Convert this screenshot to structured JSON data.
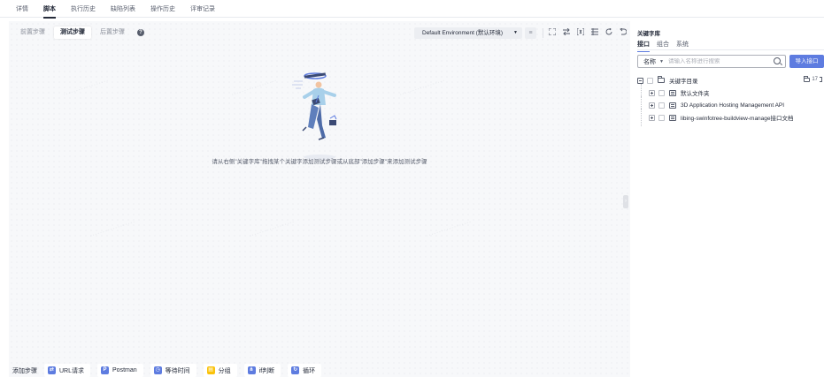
{
  "top_tabs": [
    {
      "label": "详情",
      "active": false
    },
    {
      "label": "脚本",
      "active": true
    },
    {
      "label": "执行历史",
      "active": false
    },
    {
      "label": "缺陷列表",
      "active": false
    },
    {
      "label": "操作历史",
      "active": false
    },
    {
      "label": "评审记录",
      "active": false
    }
  ],
  "editor": {
    "step_tabs": [
      {
        "label": "前置步骤",
        "active": false
      },
      {
        "label": "测试步骤",
        "active": true
      },
      {
        "label": "后置步骤",
        "active": false
      }
    ],
    "help_icon": "question-circle-icon",
    "environment": "Default Environment (默认环境)",
    "filter_icon": "filter-icon",
    "toolbar_icons": [
      "fullscreen-icon",
      "swap-icon",
      "variable-icon",
      "list-icon",
      "refresh-icon",
      "undo-icon"
    ],
    "empty_hint": "请从右侧\"关键字库\"拖拽某个关键字添加测试步骤或从底部\"添加步骤\"来添加测试步骤",
    "collapse_icon": "chevron-right-icon"
  },
  "add_bar": {
    "label": "添加步骤",
    "buttons": [
      {
        "label": "URL请求",
        "icon": "url-request-icon",
        "color": "#5e7ce0"
      },
      {
        "label": "Postman",
        "icon": "postman-icon",
        "color": "#5e7ce0"
      },
      {
        "label": "等待时间",
        "icon": "wait-time-icon",
        "color": "#5e7ce0"
      },
      {
        "label": "分组",
        "icon": "group-icon",
        "color": "#fac20a"
      },
      {
        "label": "if判断",
        "icon": "if-branch-icon",
        "color": "#5e7ce0"
      },
      {
        "label": "循环",
        "icon": "loop-icon",
        "color": "#5e7ce0"
      }
    ]
  },
  "right_panel": {
    "title": "关键字库",
    "tabs": [
      {
        "label": "接口",
        "active": true
      },
      {
        "label": "组合",
        "active": false
      },
      {
        "label": "系统",
        "active": false
      }
    ],
    "search": {
      "field": "名称",
      "placeholder": "请输入名称进行搜索"
    },
    "import_label": "导入接口",
    "tree": {
      "root": {
        "label": "关键字目录",
        "actions": "17"
      },
      "children": [
        {
          "label": "默认文件夹",
          "icon": "api-folder-icon"
        },
        {
          "label": "3D Application Hosting Management API",
          "icon": "api-folder-icon"
        },
        {
          "label": "libing-swinfotree-buildview-manage接口文档",
          "icon": "api-folder-icon"
        }
      ]
    }
  },
  "colors": {
    "primary": "#5e7ce0",
    "text": "#252b3a",
    "canvas": "#f7f8fa"
  }
}
